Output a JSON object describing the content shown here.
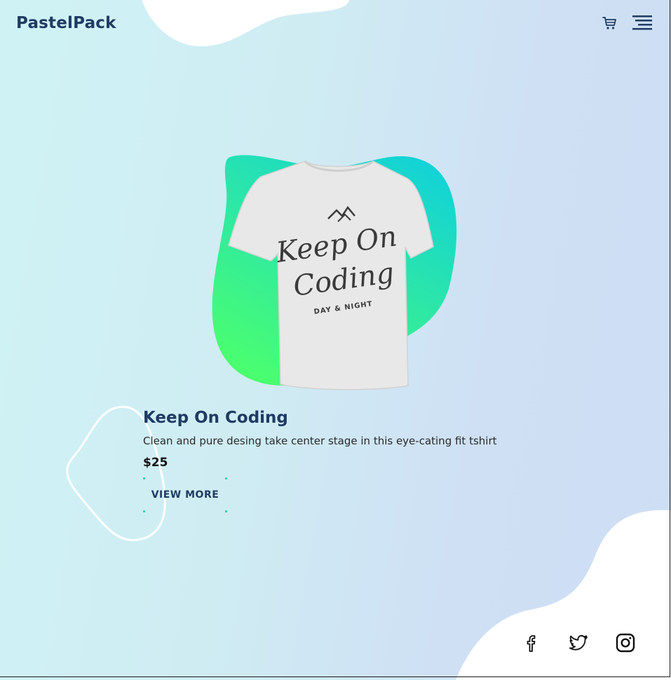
{
  "brand": {
    "name": "PastelPack"
  },
  "header": {
    "icons": [
      "cart-icon",
      "menu-icon"
    ]
  },
  "product": {
    "title": "Keep On Coding",
    "description": "Clean and pure desing take center stage in this eye-cating fit tshirt",
    "price": "$25",
    "shirt_print": {
      "line1": "Keep On",
      "line2": "Coding",
      "line3": "DAY & NIGHT"
    }
  },
  "cta": {
    "label": "VIEW MORE"
  },
  "social": {
    "icons": [
      "facebook-icon",
      "twitter-icon",
      "instagram-icon"
    ]
  },
  "colors": {
    "brand_text": "#1f3b63",
    "blob_gradient_top": "#13d3d6",
    "blob_gradient_bottom": "#4bff6e",
    "button_corner": "#2bd6a5",
    "background_start": "#cff3f5",
    "background_end": "#cdddf4"
  }
}
